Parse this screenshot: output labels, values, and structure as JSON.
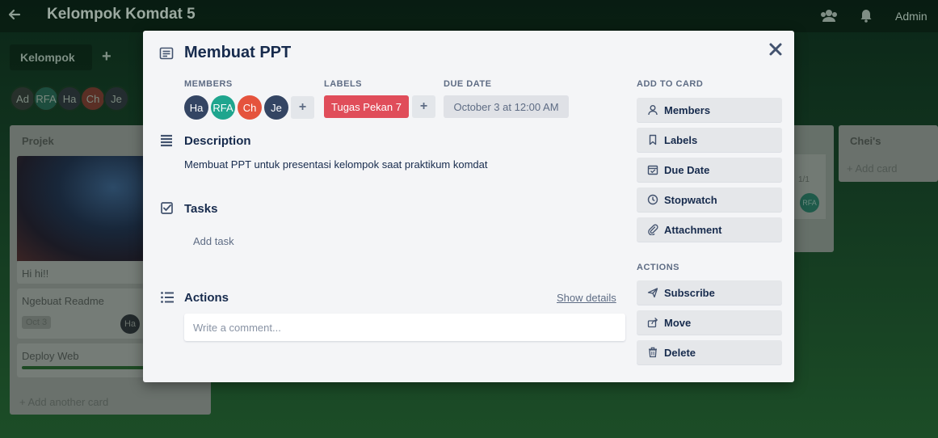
{
  "board": {
    "title": "Kelompok Komdat 5",
    "admin_label": "Admin",
    "tab_label": "Kelompok",
    "avatars": [
      {
        "initials": "Ad",
        "color": "#27302b"
      },
      {
        "initials": "RFA",
        "color": "#1d4d3e"
      },
      {
        "initials": "Ha",
        "color": "#232c2f"
      },
      {
        "initials": "Ch",
        "color": "#5a2f25"
      },
      {
        "initials": "Je",
        "color": "#232c2f"
      }
    ],
    "list": {
      "title": "Projek",
      "cards": [
        {
          "text": "Hi hi!!"
        },
        {
          "text": "Ngebuat Readme",
          "badge": "Oct 3",
          "avatar": "Ha"
        },
        {
          "text": "Deploy Web"
        }
      ],
      "add_card": "+ Add another card"
    },
    "list2": {
      "count": "1/1",
      "avatar": "RFA"
    },
    "list3": {
      "title": "Chei's",
      "add_card": "+ Add card"
    }
  },
  "card": {
    "title": "Membuat PPT",
    "members_label": "MEMBERS",
    "members": [
      {
        "initials": "Ha",
        "color": "#344563"
      },
      {
        "initials": "RFA",
        "color": "#1fa58e"
      },
      {
        "initials": "Ch",
        "color": "#e5533d"
      },
      {
        "initials": "Je",
        "color": "#344563"
      }
    ],
    "add_member": "+",
    "labels_label": "LABELS",
    "label": {
      "text": "Tugas Pekan 7",
      "color": "#e04d5a"
    },
    "add_label": "+",
    "due_label": "DUE DATE",
    "due_value": "October 3 at 12:00 AM",
    "description_title": "Description",
    "description_text": "Membuat PPT untuk presentasi kelompok saat praktikum komdat",
    "tasks_title": "Tasks",
    "add_task": "Add task",
    "actions_title": "Actions",
    "show_details": "Show details",
    "comment_placeholder": "Write a comment...",
    "close_icon": "close-icon"
  },
  "sidebar": {
    "add_to_card_label": "ADD TO CARD",
    "add_to_card": [
      {
        "label": "Members",
        "icon": "person-icon"
      },
      {
        "label": "Labels",
        "icon": "bookmark-icon"
      },
      {
        "label": "Due Date",
        "icon": "calendar-icon"
      },
      {
        "label": "Stopwatch",
        "icon": "clock-icon"
      },
      {
        "label": "Attachment",
        "icon": "paperclip-icon"
      }
    ],
    "actions_label": "ACTIONS",
    "actions": [
      {
        "label": "Subscribe",
        "icon": "send-icon"
      },
      {
        "label": "Move",
        "icon": "share-icon"
      },
      {
        "label": "Delete",
        "icon": "trash-icon"
      }
    ]
  }
}
